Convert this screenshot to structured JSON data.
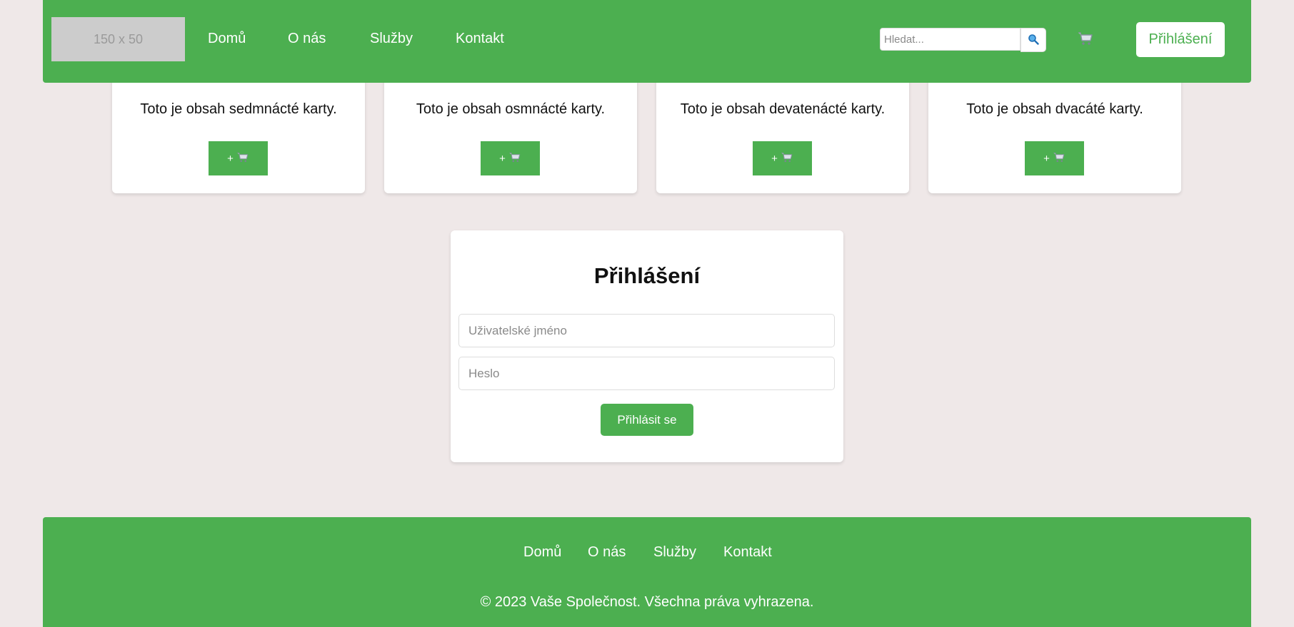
{
  "header": {
    "logo_text": "150 x 50",
    "nav": [
      {
        "label": "Domů"
      },
      {
        "label": "O nás"
      },
      {
        "label": "Služby"
      },
      {
        "label": "Kontakt"
      }
    ],
    "search": {
      "placeholder": "Hledat...",
      "value": "",
      "icon": "search-icon"
    },
    "cart_icon": "cart-icon",
    "login_label": "Přihlášení"
  },
  "cards": [
    {
      "text": "Toto je obsah sedmnácté karty.",
      "button_label": "+",
      "button_icon": "cart-icon"
    },
    {
      "text": "Toto je obsah osmnácté karty.",
      "button_label": "+",
      "button_icon": "cart-icon"
    },
    {
      "text": "Toto je obsah devatenácté karty.",
      "button_label": "+",
      "button_icon": "cart-icon"
    },
    {
      "text": "Toto je obsah dvacáté karty.",
      "button_label": "+",
      "button_icon": "cart-icon"
    }
  ],
  "login": {
    "title": "Přihlášení",
    "username_placeholder": "Uživatelské jméno",
    "username_value": "",
    "password_placeholder": "Heslo",
    "password_value": "",
    "submit_label": "Přihlásit se"
  },
  "footer": {
    "nav": [
      {
        "label": "Domů"
      },
      {
        "label": "O nás"
      },
      {
        "label": "Služby"
      },
      {
        "label": "Kontakt"
      }
    ],
    "copyright": "© 2023 Vaše Společnost. Všechna práva vyhrazena."
  },
  "colors": {
    "brand_green": "#4caf50",
    "page_background": "#efe8e8",
    "card_background": "#ffffff",
    "logo_placeholder": "#cccccc"
  }
}
